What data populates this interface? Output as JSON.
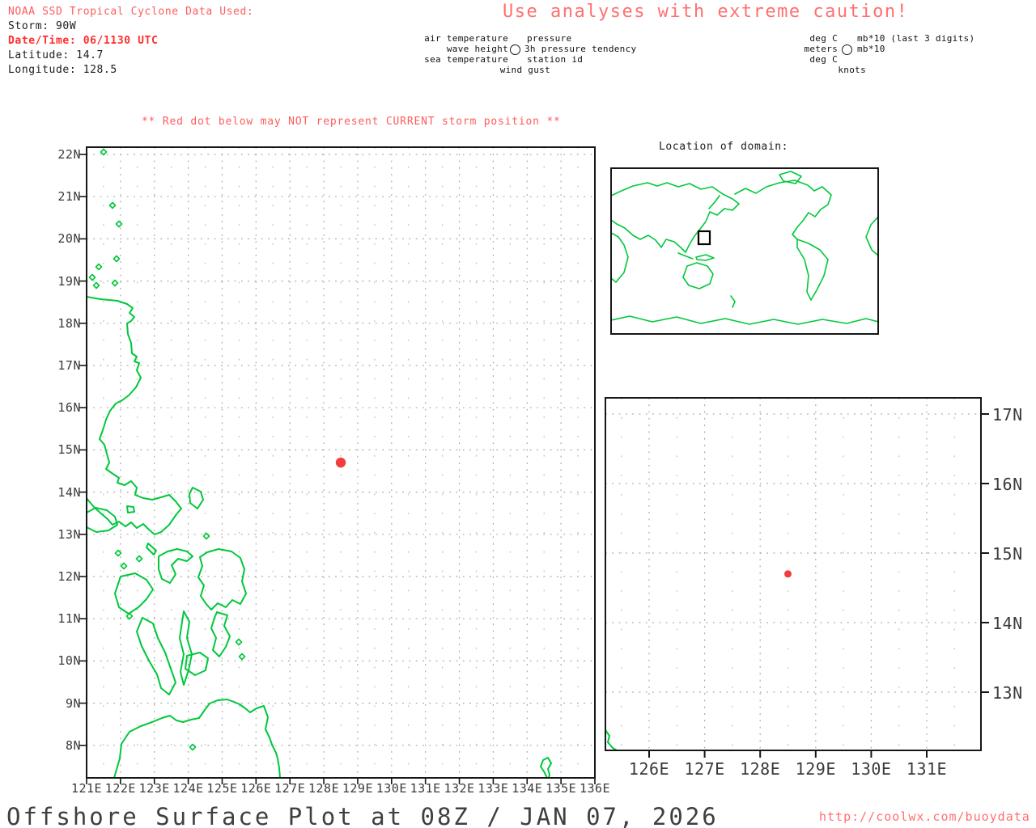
{
  "header": {
    "source_line": "NOAA SSD Tropical Cyclone Data Used:",
    "storm_line": "Storm: 90W",
    "datetime_line": "Date/Time: 06/1130 UTC",
    "latitude_line": "Latitude: 14.7",
    "longitude_line": "Longitude: 128.5"
  },
  "caution_banner": "Use analyses with extreme caution!",
  "station_legend": {
    "params": {
      "top_left": "air temperature",
      "top_right": "pressure",
      "mid_left": "wave height",
      "mid_right": "3h pressure tendency",
      "bottom_left": "sea temperature",
      "bottom_right": "station id",
      "below": "wind gust"
    },
    "units": {
      "top_left": "deg C",
      "top_right": "mb*10 (last 3 digits)",
      "mid_left": "meters",
      "mid_right": "mb*10",
      "bottom_left": "deg C",
      "below": "knots"
    }
  },
  "storm_warning": "** Red dot below may NOT represent CURRENT storm position **",
  "main_map": {
    "lat_tick_labels": [
      "22N",
      "21N",
      "20N",
      "19N",
      "18N",
      "17N",
      "16N",
      "15N",
      "14N",
      "13N",
      "12N",
      "11N",
      "10N",
      "9N",
      "8N"
    ],
    "lat_tick_values": [
      22,
      21,
      20,
      19,
      18,
      17,
      16,
      15,
      14,
      13,
      12,
      11,
      10,
      9,
      8
    ],
    "lon_tick_labels": [
      "121E",
      "122E",
      "123E",
      "124E",
      "125E",
      "126E",
      "127E",
      "128E",
      "129E",
      "130E",
      "131E",
      "132E",
      "133E",
      "134E",
      "135E",
      "136E"
    ],
    "lon_tick_values": [
      121,
      122,
      123,
      124,
      125,
      126,
      127,
      128,
      129,
      130,
      131,
      132,
      133,
      134,
      135,
      136
    ],
    "storm_dot": {
      "lat": 14.7,
      "lon": 128.5
    }
  },
  "inset_map": {
    "title": "Location of domain:"
  },
  "detail_map": {
    "lat_tick_labels": [
      "17N",
      "16N",
      "15N",
      "14N",
      "13N"
    ],
    "lat_tick_values": [
      17,
      16,
      15,
      14,
      13
    ],
    "lon_tick_labels": [
      "126E",
      "127E",
      "128E",
      "129E",
      "130E",
      "131E"
    ],
    "lon_tick_values": [
      126,
      127,
      128,
      129,
      130,
      131
    ],
    "storm_dot": {
      "lat": 14.7,
      "lon": 128.5
    }
  },
  "footer": {
    "plot_title": "Offshore Surface Plot at 08Z / JAN 07, 2026",
    "site_url": "http://coolwx.com/buoydata"
  },
  "colors": {
    "alert-red": "#ff5c5c",
    "bold-red": "#ff2d2d",
    "banner-red": "#ff7070",
    "coast-green": "#00c83c",
    "dot-red": "#f23d3d",
    "grid-gray": "#a6a6a6",
    "axis-gray": "#3a3a3a",
    "title-gray": "#3f3f3f"
  }
}
